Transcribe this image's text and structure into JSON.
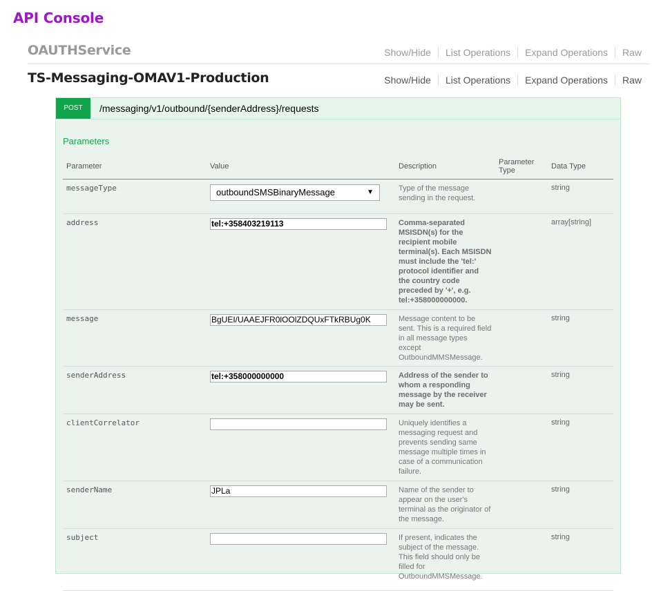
{
  "app_title": "API Console",
  "resources": [
    {
      "name": "OAUTHService",
      "ops": [
        "Show/Hide",
        "List Operations",
        "Expand Operations",
        "Raw"
      ]
    },
    {
      "name": "TS-Messaging-OMAV1-Production",
      "ops": [
        "Show/Hide",
        "List Operations",
        "Expand Operations",
        "Raw"
      ]
    }
  ],
  "operation": {
    "method": "POST",
    "path": "/messaging/v1/outbound/{senderAddress}/requests",
    "parameters_title": "Parameters",
    "headers": [
      "Parameter",
      "Value",
      "Description",
      "Parameter Type",
      "Data Type"
    ],
    "rows": [
      {
        "name": "messageType",
        "value": "outboundSMSBinaryMessage",
        "description": "Type of the message sending in the request.",
        "param_type": "",
        "data_type": "string"
      },
      {
        "name": "address",
        "value": "tel:+358403219113",
        "description": "Comma-separated MSISDN(s) for the recipient mobile terminal(s). Each MSISDN must include the 'tel:' protocol identifier and the country code preceded by '+', e.g. tel:+358000000000.",
        "param_type": "",
        "data_type": "array[string]"
      },
      {
        "name": "message",
        "value": "BgUEI/UAAEJFR0lOOlZDQUxFTkRBUg0K",
        "description": "Message content to be sent. This is a required field in all message types except OutboundMMSMessage.",
        "param_type": "",
        "data_type": "string"
      },
      {
        "name": "senderAddress",
        "value": "tel:+358000000000",
        "description": "Address of the sender to whom a responding message by the receiver may be sent.",
        "param_type": "",
        "data_type": "string"
      },
      {
        "name": "clientCorrelator",
        "value": "",
        "description": "Uniquely identifies a messaging request and prevents sending same message multiple times in case of a communication failure.",
        "param_type": "",
        "data_type": "string"
      },
      {
        "name": "senderName",
        "value": "JPLa",
        "description": "Name of the sender to appear on the user's terminal as the originator of the message.",
        "param_type": "",
        "data_type": "string"
      },
      {
        "name": "subject",
        "value": "",
        "description": "If present, indicates the subject of the message. This field should only be filled for OutboundMMSMessage.",
        "param_type": "",
        "data_type": "string"
      }
    ]
  },
  "colors": {
    "app_title": "#9b19c4",
    "post_badge": "#10a54a",
    "operation_bg": "#ebf3ee",
    "parameters_title": "#10a54a"
  },
  "icons": {
    "select_arrow": "caret-down-icon"
  }
}
